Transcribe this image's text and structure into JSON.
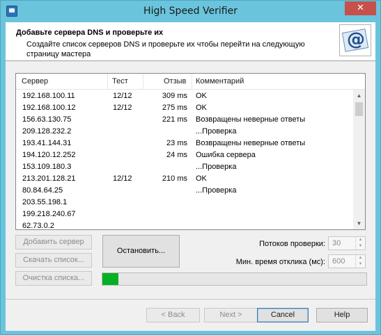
{
  "window": {
    "title": "High Speed Verifier",
    "close_glyph": "✕"
  },
  "header": {
    "title": "Добавьте сервера DNS и проверьте их",
    "description": "Создайте список серверов DNS и проверьте их чтобы перейти на следующую страницу мастера"
  },
  "table": {
    "columns": [
      "Сервер",
      "Тест",
      "Отзыв",
      "Комментарий"
    ],
    "rows": [
      {
        "server": "192.168.100.11",
        "test": "12/12",
        "ping": "309 ms",
        "comment": "OK"
      },
      {
        "server": "192.168.100.12",
        "test": "12/12",
        "ping": "275 ms",
        "comment": "OK"
      },
      {
        "server": "156.63.130.75",
        "test": "",
        "ping": "221 ms",
        "comment": "Возвращены неверные ответы"
      },
      {
        "server": "209.128.232.2",
        "test": "",
        "ping": "",
        "comment": "...Проверка"
      },
      {
        "server": "193.41.144.31",
        "test": "",
        "ping": "23 ms",
        "comment": "Возвращены неверные ответы"
      },
      {
        "server": "194.120.12.252",
        "test": "",
        "ping": "24 ms",
        "comment": "Ошибка сервера"
      },
      {
        "server": "153.109.180.3",
        "test": "",
        "ping": "",
        "comment": "...Проверка"
      },
      {
        "server": "213.201.128.21",
        "test": "12/12",
        "ping": "210 ms",
        "comment": "OK"
      },
      {
        "server": "80.84.64.25",
        "test": "",
        "ping": "",
        "comment": "...Проверка"
      },
      {
        "server": "203.55.198.1",
        "test": "",
        "ping": "",
        "comment": ""
      },
      {
        "server": "199.218.240.67",
        "test": "",
        "ping": "",
        "comment": ""
      },
      {
        "server": "62.73.0.2",
        "test": "",
        "ping": "",
        "comment": ""
      }
    ]
  },
  "buttons": {
    "add_server": "Добавить сервер",
    "download_list": "Скачать список...",
    "clear_list": "Очистка списка...",
    "stop": "Остановить...",
    "back": "< Back",
    "next": "Next >",
    "cancel": "Cancel",
    "help": "Help"
  },
  "settings": {
    "threads_label": "Потоков проверки:",
    "threads_value": "30",
    "min_response_label": "Мин. время отклика (мс):",
    "min_response_value": "600"
  },
  "progress": {
    "percent": 6,
    "fill_color": "#06b025"
  }
}
